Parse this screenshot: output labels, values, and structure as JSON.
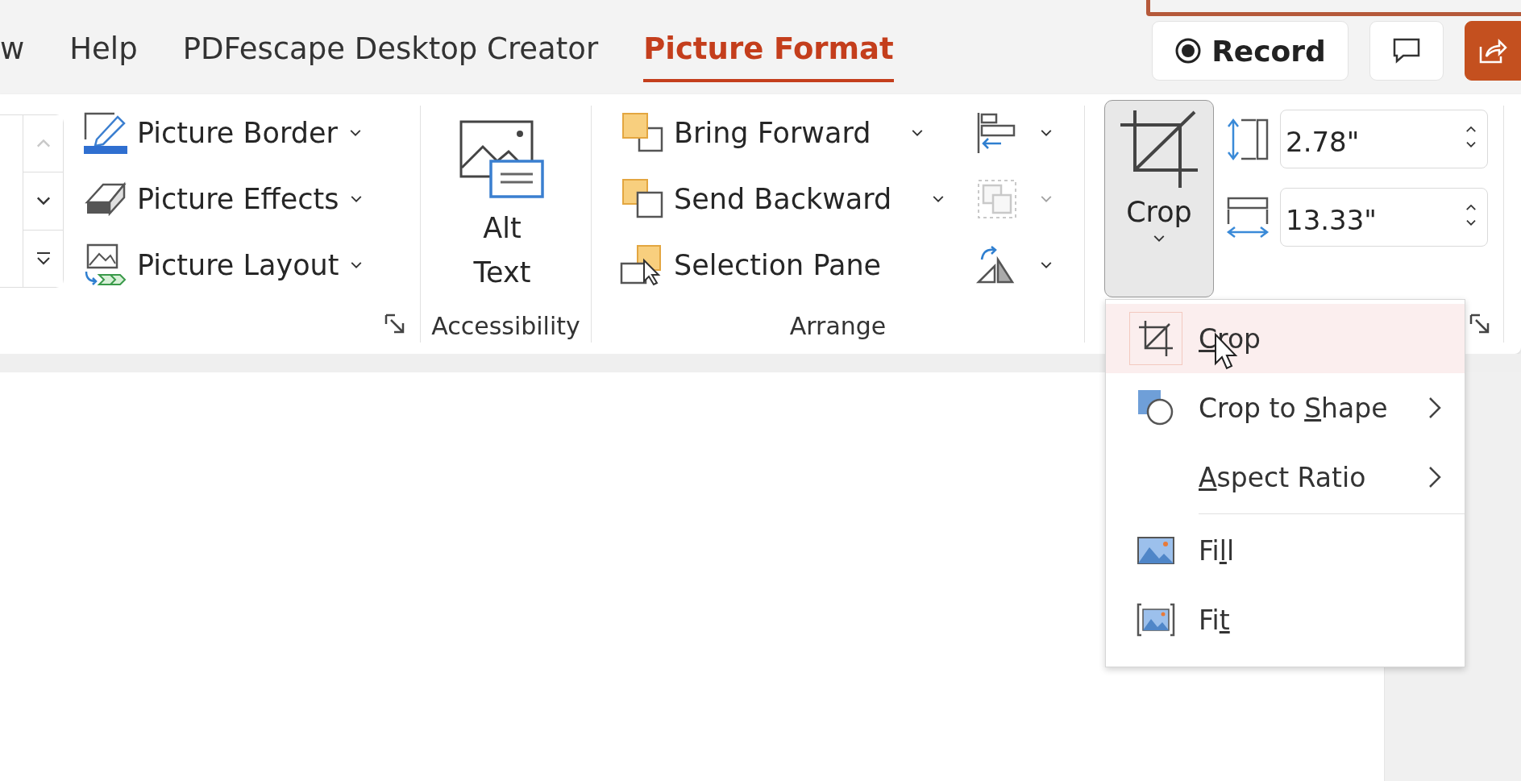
{
  "tabs": [
    {
      "label": "w",
      "selected": false
    },
    {
      "label": "Help",
      "selected": false
    },
    {
      "label": "PDFescape Desktop Creator",
      "selected": false
    },
    {
      "label": "Picture Format",
      "selected": true
    }
  ],
  "record_button": {
    "label": "Record"
  },
  "ribbon": {
    "gallery": {
      "scroll_up_disabled": true
    },
    "picture_styles": {
      "rows": [
        {
          "label": "Picture Border"
        },
        {
          "label": "Picture Effects"
        },
        {
          "label": "Picture Layout"
        }
      ]
    },
    "accessibility": {
      "button": "Alt Text",
      "name": "Accessibility"
    },
    "arrange": {
      "name": "Arrange",
      "rows": [
        {
          "label": "Bring Forward",
          "dropdown": true
        },
        {
          "label": "Send Backward",
          "dropdown": true
        },
        {
          "label": "Selection Pane",
          "dropdown": false
        }
      ],
      "side_buttons": [
        {
          "disabled": false
        },
        {
          "disabled": true
        },
        {
          "disabled": false
        }
      ]
    },
    "size": {
      "crop_button": {
        "label": "Crop",
        "pressed": true
      },
      "height": "2.78\"",
      "width": "13.33\""
    }
  },
  "crop_menu": {
    "items": [
      {
        "key": "C",
        "after": "rop",
        "highlighted": true,
        "submenu": false,
        "separator_before": false
      },
      {
        "before": "Crop to ",
        "key": "S",
        "after": "hape",
        "highlighted": false,
        "submenu": true,
        "separator_before": false
      },
      {
        "key": "A",
        "after": "spect Ratio",
        "highlighted": false,
        "submenu": true,
        "separator_before": false
      },
      {
        "before": "Fi",
        "key": "l",
        "after": "l",
        "highlighted": false,
        "submenu": false,
        "separator_before": true
      },
      {
        "before": "Fi",
        "key": "t",
        "highlighted": false,
        "submenu": false,
        "separator_before": false
      }
    ]
  }
}
